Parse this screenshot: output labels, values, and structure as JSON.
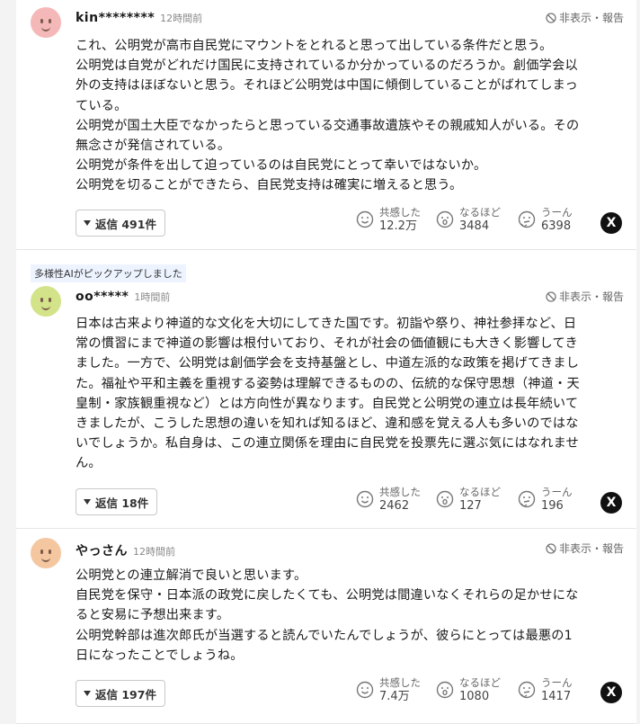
{
  "comments": [
    {
      "avatar_color": "#f4b8b8",
      "username": "kin********",
      "time": "12時間前",
      "hide_label": "非表示・報告",
      "badge": "",
      "lines": [
        "これ、公明党が高市自民党にマウントをとれると思って出している条件だと思う。",
        "公明党は自党がどれだけ国民に支持されているか分かっているのだろうか。創価学会以",
        "外の支持はほぼないと思う。それほど公明党は中国に傾倒していることがばれてしまっ",
        "ている。",
        "公明党が国土大臣でなかったらと思っている交通事故遺族やその親戚知人がいる。その",
        "無念さが発信されている。",
        "公明党が条件を出して迫っているのは自民党にとって幸いではないか。",
        "公明党を切ることができたら、自民党支持は確実に増えると思う。"
      ],
      "reply_label": "返信 491件",
      "reactions": [
        {
          "icon": "smile-empathy-icon",
          "label": "共感した",
          "count": "12.2万"
        },
        {
          "icon": "surprise-icon",
          "label": "なるほど",
          "count": "3484"
        },
        {
          "icon": "thinking-icon",
          "label": "うーん",
          "count": "6398"
        }
      ]
    },
    {
      "avatar_color": "#d3e38a",
      "username": "oo*****",
      "time": "1時間前",
      "hide_label": "非表示・報告",
      "badge": "多様性AIがピックアップしました",
      "lines": [
        "日本は古来より神道的な文化を大切にしてきた国です。初詣や祭り、神社参拝など、日",
        "常の慣習にまで神道の影響は根付いており、それが社会の価値観にも大きく影響してき",
        "ました。一方で、公明党は創価学会を支持基盤とし、中道左派的な政策を掲げてきまし",
        "た。福祉や平和主義を重視する姿勢は理解できるものの、伝統的な保守思想（神道・天",
        "皇制・家族観重視など）とは方向性が異なります。自民党と公明党の連立は長年続いて",
        "きましたが、こうした思想の違いを知れば知るほど、違和感を覚える人も多いのではな",
        "いでしょうか。私自身は、この連立関係を理由に自民党を投票先に選ぶ気にはなれませ",
        "ん。"
      ],
      "reply_label": "返信 18件",
      "reactions": [
        {
          "icon": "smile-empathy-icon",
          "label": "共感した",
          "count": "2462"
        },
        {
          "icon": "surprise-icon",
          "label": "なるほど",
          "count": "127"
        },
        {
          "icon": "thinking-icon",
          "label": "うーん",
          "count": "196"
        }
      ]
    },
    {
      "avatar_color": "#f4c7a0",
      "username": "やっさん",
      "time": "12時間前",
      "hide_label": "非表示・報告",
      "badge": "",
      "lines": [
        "公明党との連立解消で良いと思います。",
        "自民党を保守・日本派の政党に戻したくても、公明党は間違いなくそれらの足かせにな",
        "ると安易に予想出来ます。",
        "公明党幹部は進次郎氏が当選すると読んでいたんでしょうが、彼らにとっては最悪の1",
        "日になったことでしょうね。"
      ],
      "reply_label": "返信 197件",
      "reactions": [
        {
          "icon": "smile-empathy-icon",
          "label": "共感した",
          "count": "7.4万"
        },
        {
          "icon": "surprise-icon",
          "label": "なるほど",
          "count": "1080"
        },
        {
          "icon": "thinking-icon",
          "label": "うーん",
          "count": "1417"
        }
      ]
    }
  ],
  "share": {
    "icon": "x-share-icon",
    "glyph": "X"
  }
}
